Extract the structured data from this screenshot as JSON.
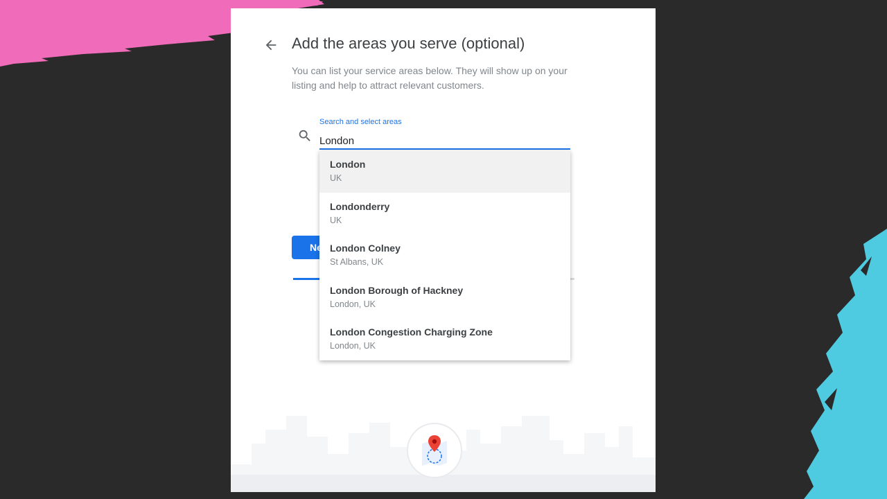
{
  "header": {
    "title": "Add the areas you serve (optional)",
    "subtitle": "You can list your service areas below. They will show up on your listing and help to attract relevant customers."
  },
  "search": {
    "label": "Search and select areas",
    "value": "London"
  },
  "suggestions": [
    {
      "name": "London",
      "sub": "UK",
      "highlighted": true
    },
    {
      "name": "Londonderry",
      "sub": "UK"
    },
    {
      "name": "London Colney",
      "sub": "St Albans, UK"
    },
    {
      "name": "London Borough of Hackney",
      "sub": "London, UK"
    },
    {
      "name": "London Congestion Charging Zone",
      "sub": "London, UK"
    }
  ],
  "next_button": {
    "label": "Next"
  },
  "progress": {
    "fraction": 0.1
  },
  "icons": {
    "back": "arrow-left-icon",
    "search": "search-icon",
    "map": "map-pin-icon"
  },
  "colors": {
    "accent": "#1a73e8",
    "background": "#2a2a2a",
    "decor_pink": "#f06bb9",
    "decor_cyan": "#4ecbe0",
    "pin": "#ea4335"
  }
}
